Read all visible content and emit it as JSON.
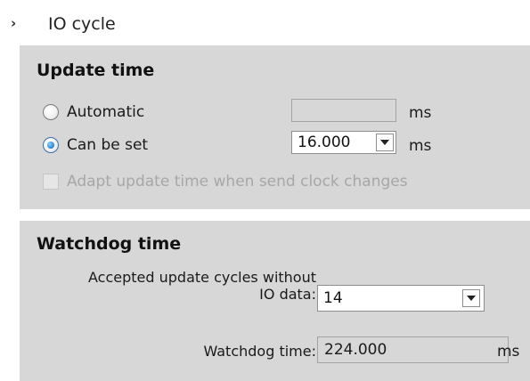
{
  "section": {
    "title": "IO cycle"
  },
  "update_time": {
    "title": "Update time",
    "automatic": {
      "label": "Automatic",
      "selected": false,
      "value": "",
      "unit": "ms"
    },
    "can_be_set": {
      "label": "Can be set",
      "selected": true,
      "value": "16.000",
      "unit": "ms"
    },
    "adapt_checkbox": {
      "label": "Adapt update time when send clock changes",
      "checked": false,
      "enabled": false
    }
  },
  "watchdog_time": {
    "title": "Watchdog time",
    "accepted_cycles": {
      "label_line1": "Accepted update cycles without",
      "label_line2": "IO data:",
      "value": "14"
    },
    "watchdog": {
      "label": "Watchdog time:",
      "value": "224.000",
      "unit": "ms"
    }
  }
}
